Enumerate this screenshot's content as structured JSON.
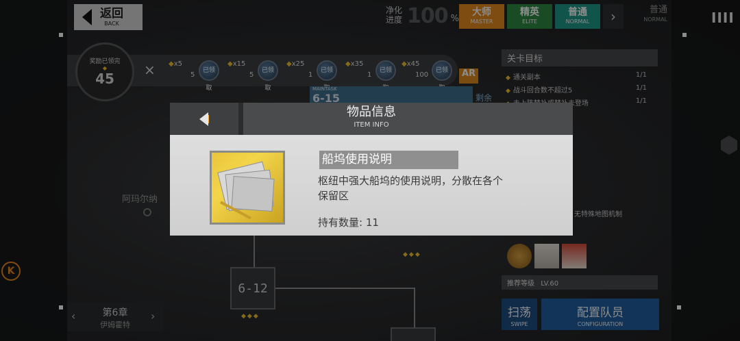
{
  "topbar": {
    "back_zh": "返回",
    "back_en": "BACK",
    "purify_label_line1": "净化",
    "purify_label_line2": "进度",
    "purify_value": "100",
    "purify_unit": "%",
    "difficulties": [
      {
        "zh": "大师",
        "en": "MASTER",
        "color": "#e58a1e"
      },
      {
        "zh": "精英",
        "en": "ELITE",
        "color": "#2f8a44"
      },
      {
        "zh": "普通",
        "en": "NORMAL",
        "color": "#1e9a8a"
      }
    ],
    "current_mode_zh": "普通",
    "current_mode_en": "NORMAL",
    "menu_glyph": "IIII"
  },
  "rewards": {
    "claimed_label": "奖励已领完",
    "total": "45",
    "close_glyph": "×",
    "items": [
      {
        "req": "x5",
        "count": "5",
        "status": "已领取"
      },
      {
        "req": "x15",
        "count": "5",
        "status": "已领取"
      },
      {
        "req": "x25",
        "count": "1",
        "status": "已领取"
      },
      {
        "req": "x35",
        "count": "1",
        "status": "已领取"
      },
      {
        "req": "x45",
        "count": "100",
        "status": "已领取"
      }
    ]
  },
  "stage_header": {
    "tag": "MAINTASK",
    "stage": "6-15",
    "suffix": "AR",
    "remaining": "剩余"
  },
  "map": {
    "place_name": "阿玛尔纳",
    "node_label": "6-12",
    "chapter_zh": "第6章",
    "chapter_name": "伊姆霍特"
  },
  "right_panel": {
    "objectives_title": "关卡目标",
    "objectives": [
      {
        "text": "通关副本",
        "progress": "1/1"
      },
      {
        "text": "战斗回合数不超过5",
        "progress": "1/1"
      },
      {
        "text": "未上阵替补或替补未登场",
        "progress": "1/1"
      }
    ],
    "no_map_mech": "无特殊地图机制",
    "rec_level_label": "推荐等级",
    "rec_level": "LV.60",
    "sweep_zh": "扫荡",
    "sweep_en": "SWIPE",
    "config_zh": "配置队员",
    "config_en": "CONFIGURATION"
  },
  "modal": {
    "title_zh": "物品信息",
    "title_en": "ITEM INFO",
    "item_name": "船坞使用说明",
    "item_desc_line1": "枢纽中强大船坞的使用说明，分散在各个",
    "item_desc_line2": "保留区",
    "qty_label": "持有数量: ",
    "qty_value": "11"
  },
  "side_badge": "K"
}
